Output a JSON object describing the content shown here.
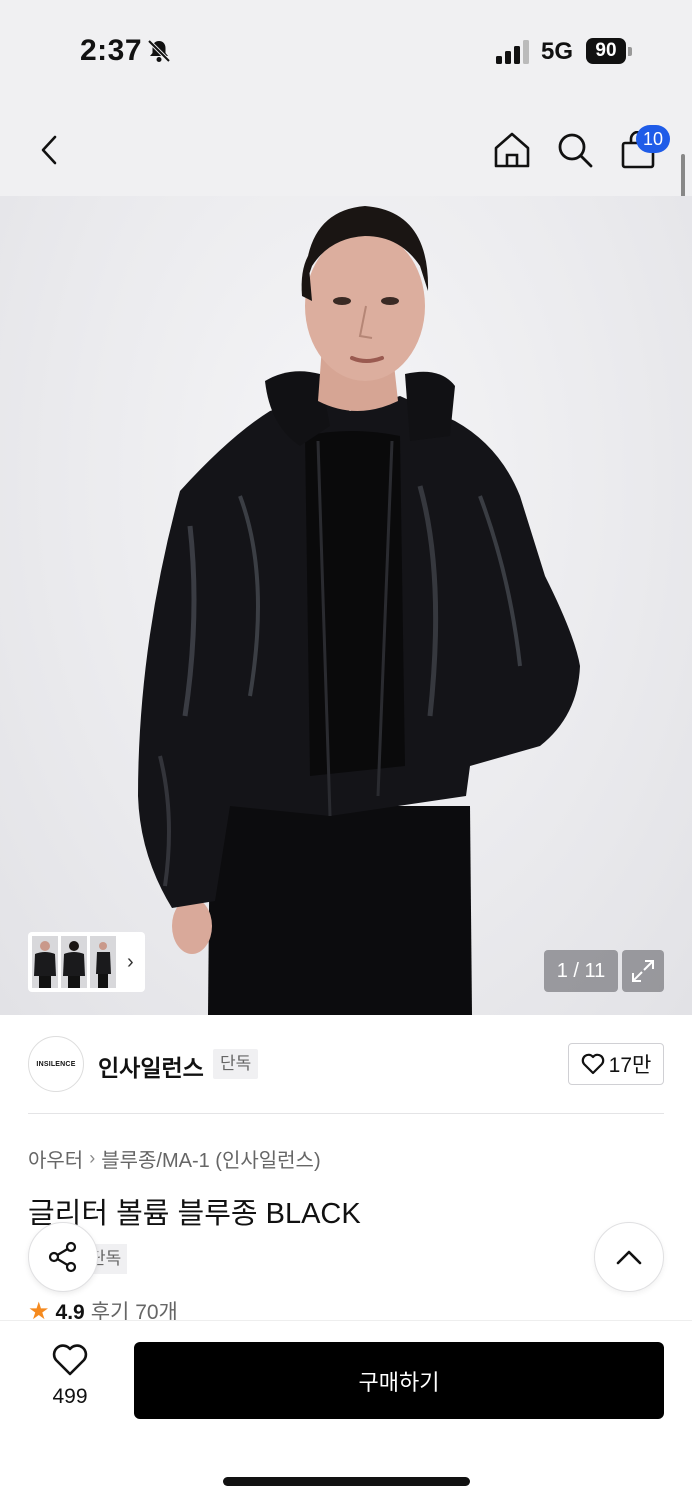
{
  "status": {
    "time": "2:37",
    "network": "5G",
    "battery": "90"
  },
  "nav": {
    "cart_badge": "10"
  },
  "gallery": {
    "counter": "1 / 11"
  },
  "brand": {
    "logo_text": "INSILENCE",
    "name": "인사일런스",
    "tag": "단독",
    "likes": "17만"
  },
  "breadcrumb": {
    "category": "아우터",
    "subcategory": "블루종/MA-1 (인사일런스)"
  },
  "product": {
    "title": "글리터 볼륨 블루종 BLACK",
    "tag": "단독",
    "rating": "4.9",
    "reviews": "후기 70개"
  },
  "bottom": {
    "wish_count": "499",
    "buy_label": "구매하기"
  },
  "icons": [
    "bell-slash-icon",
    "signal-icon",
    "back-icon",
    "home-icon",
    "search-icon",
    "cart-icon",
    "expand-icon",
    "heart-icon",
    "share-icon",
    "chevron-up-icon",
    "star-icon",
    "chevron-right-icon"
  ],
  "colors": {
    "accent_blue": "#1f5ce8",
    "buy_button": "#000000",
    "star": "#f58a1f"
  }
}
